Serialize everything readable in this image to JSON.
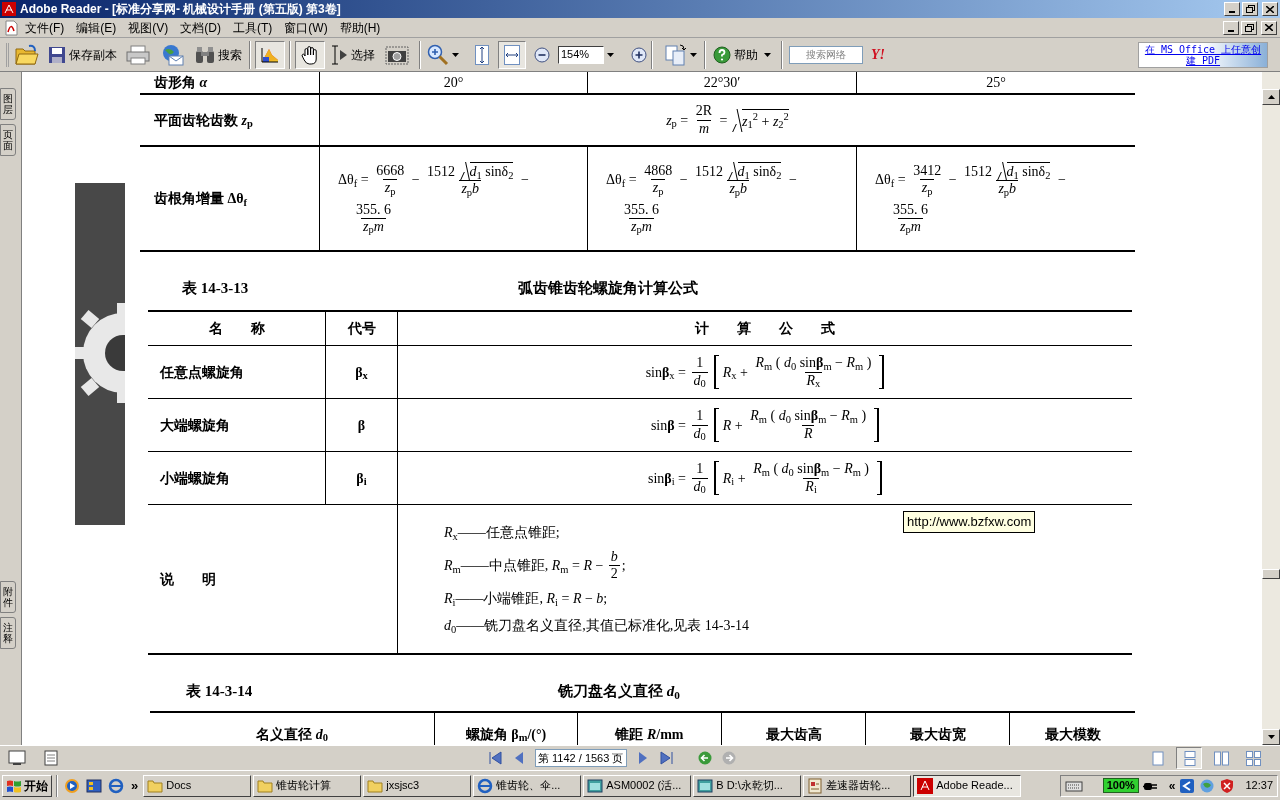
{
  "window": {
    "title": "Adobe Reader - [标准分享网- 机械设计手册 (第五版) 第3卷]"
  },
  "menu": [
    "文件(F)",
    "编辑(E)",
    "视图(V)",
    "文档(D)",
    "工具(T)",
    "窗口(W)",
    "帮助(H)"
  ],
  "toolbar": {
    "save_copy": "保存副本",
    "search": "搜索",
    "color_tool": {
      "selected": true
    },
    "hand_tool": {
      "selected": true
    },
    "select_tool": {
      "label": "选择",
      "selected": false
    },
    "fit_page": {
      "selected": false
    },
    "fit_width": {
      "selected": true
    },
    "zoom": "154%",
    "help": "帮助",
    "web_search": {
      "placeholder": "搜索网络"
    },
    "yahoo": "Y!",
    "promo_link": "在 MS Office 上任意创建 PDF"
  },
  "nav_tabs_top": [
    "图层",
    "页面"
  ],
  "nav_tabs_bottom": [
    "附件",
    "注释"
  ],
  "table_1": {
    "rows": [
      {
        "label": "齿形角 *α*",
        "cells": [
          {
            "kind": "text",
            "text": "20°"
          },
          {
            "kind": "text",
            "text": "22°30′"
          },
          {
            "kind": "text",
            "text": "25°"
          }
        ]
      },
      {
        "label": "平面齿轮齿数 *z*$_{p}$",
        "formula": {
          "lines": [
            [
              {
                "kind": "t",
                "text": "*z*$_{p}$ = "
              },
              {
                "kind": "frac",
                "num": [
                  {
                    "kind": "t",
                    "text": "2R"
                  }
                ],
                "den": [
                  {
                    "kind": "t",
                    "text": "*m*"
                  }
                ]
              },
              {
                "kind": "t",
                "text": " = "
              },
              {
                "kind": "sqrt",
                "body": [
                  {
                    "kind": "t",
                    "text": "*z*$_{1}$$^{2}$ + *z*$_{2}$$^{2}$"
                  }
                ]
              }
            ]
          ]
        }
      },
      {
        "label": "齿根角增量 Δθ$_{f}$",
        "cells": [
          {
            "kind": "formula",
            "lines": [
              [
                {
                  "kind": "t",
                  "text": "Δθ$_{f}$ = "
                },
                {
                  "kind": "frac",
                  "num": [
                    {
                      "kind": "t",
                      "text": "6668"
                    }
                  ],
                  "den": [
                    {
                      "kind": "t",
                      "text": "*z*$_{p}$"
                    }
                  ]
                },
                {
                  "kind": "t",
                  "text": " − "
                },
                {
                  "kind": "frac",
                  "num": [
                    {
                      "kind": "t",
                      "text": "1512 "
                    },
                    {
                      "kind": "sqrt",
                      "body": [
                        {
                          "kind": "t",
                          "text": "*d*$_{1}$ sinδ$_{2}$"
                        }
                      ]
                    }
                  ],
                  "den": [
                    {
                      "kind": "t",
                      "text": "*z*$_{p}$*b*"
                    }
                  ]
                },
                {
                  "kind": "t",
                  "text": " −"
                }
              ],
              [
                {
                  "kind": "frac",
                  "num": [
                    {
                      "kind": "t",
                      "text": "355. 6"
                    }
                  ],
                  "den": [
                    {
                      "kind": "t",
                      "text": "*z*$_{p}$*m*"
                    }
                  ]
                }
              ]
            ]
          },
          {
            "kind": "formula",
            "lines": [
              [
                {
                  "kind": "t",
                  "text": "Δθ$_{f}$ = "
                },
                {
                  "kind": "frac",
                  "num": [
                    {
                      "kind": "t",
                      "text": "4868"
                    }
                  ],
                  "den": [
                    {
                      "kind": "t",
                      "text": "*z*$_{p}$"
                    }
                  ]
                },
                {
                  "kind": "t",
                  "text": " − "
                },
                {
                  "kind": "frac",
                  "num": [
                    {
                      "kind": "t",
                      "text": "1512 "
                    },
                    {
                      "kind": "sqrt",
                      "body": [
                        {
                          "kind": "t",
                          "text": "*d*$_{1}$ sinδ$_{2}$"
                        }
                      ]
                    }
                  ],
                  "den": [
                    {
                      "kind": "t",
                      "text": "*z*$_{p}$*b*"
                    }
                  ]
                },
                {
                  "kind": "t",
                  "text": " −"
                }
              ],
              [
                {
                  "kind": "frac",
                  "num": [
                    {
                      "kind": "t",
                      "text": "355. 6"
                    }
                  ],
                  "den": [
                    {
                      "kind": "t",
                      "text": "*z*$_{p}$*m*"
                    }
                  ]
                }
              ]
            ]
          },
          {
            "kind": "formula",
            "lines": [
              [
                {
                  "kind": "t",
                  "text": "Δθ$_{f}$ = "
                },
                {
                  "kind": "frac",
                  "num": [
                    {
                      "kind": "t",
                      "text": "3412"
                    }
                  ],
                  "den": [
                    {
                      "kind": "t",
                      "text": "*z*$_{p}$"
                    }
                  ]
                },
                {
                  "kind": "t",
                  "text": " − "
                },
                {
                  "kind": "frac",
                  "num": [
                    {
                      "kind": "t",
                      "text": "1512 "
                    },
                    {
                      "kind": "sqrt",
                      "body": [
                        {
                          "kind": "t",
                          "text": "*d*$_{1}$ sinδ$_{2}$"
                        }
                      ]
                    }
                  ],
                  "den": [
                    {
                      "kind": "t",
                      "text": "*z*$_{p}$*b*"
                    }
                  ]
                },
                {
                  "kind": "t",
                  "text": " −"
                }
              ],
              [
                {
                  "kind": "frac",
                  "num": [
                    {
                      "kind": "t",
                      "text": "355. 6"
                    }
                  ],
                  "den": [
                    {
                      "kind": "t",
                      "text": "*z*$_{p}$*m*"
                    }
                  ]
                }
              ]
            ]
          }
        ]
      }
    ]
  },
  "table_2": {
    "number": "表 14-3-13",
    "title": "弧齿锥齿轮螺旋角计算公式",
    "columns": [
      "名　　称",
      "代号",
      "计　　算　　公　　式"
    ],
    "rows": [
      {
        "name": "任意点螺旋角",
        "symbol": "**β**$_{x}$",
        "formula": [
          {
            "kind": "t",
            "text": "sin**β**$_{x}$ = "
          },
          {
            "kind": "frac",
            "num": [
              {
                "kind": "t",
                "text": "1"
              }
            ],
            "den": [
              {
                "kind": "t",
                "text": "*d*$_{0}$"
              }
            ]
          },
          {
            "kind": "bracket",
            "body": [
              {
                "kind": "t",
                "text": "*R*$_{x}$ + "
              },
              {
                "kind": "frac",
                "num": [
                  {
                    "kind": "t",
                    "text": "*R*$_{m}$ ( *d*$_{0}$ sin**β**$_{m}$ − *R*$_{m}$ )"
                  }
                ],
                "den": [
                  {
                    "kind": "t",
                    "text": "*R*$_{x}$"
                  }
                ]
              }
            ]
          }
        ]
      },
      {
        "name": "大端螺旋角",
        "symbol": "**β**",
        "formula": [
          {
            "kind": "t",
            "text": "sin**β** = "
          },
          {
            "kind": "frac",
            "num": [
              {
                "kind": "t",
                "text": "1"
              }
            ],
            "den": [
              {
                "kind": "t",
                "text": "*d*$_{0}$"
              }
            ]
          },
          {
            "kind": "bracket",
            "body": [
              {
                "kind": "t",
                "text": "*R* + "
              },
              {
                "kind": "frac",
                "num": [
                  {
                    "kind": "t",
                    "text": "*R*$_{m}$ ( *d*$_{0}$ sin**β**$_{m}$ − *R*$_{m}$ )"
                  }
                ],
                "den": [
                  {
                    "kind": "t",
                    "text": "*R*"
                  }
                ]
              }
            ]
          }
        ]
      },
      {
        "name": "小端螺旋角",
        "symbol": "**β**$_{i}$",
        "formula": [
          {
            "kind": "t",
            "text": "sin**β**$_{i}$ = "
          },
          {
            "kind": "frac",
            "num": [
              {
                "kind": "t",
                "text": "1"
              }
            ],
            "den": [
              {
                "kind": "t",
                "text": "*d*$_{0}$"
              }
            ]
          },
          {
            "kind": "bracket",
            "body": [
              {
                "kind": "t",
                "text": "*R*$_{i}$ + "
              },
              {
                "kind": "frac",
                "num": [
                  {
                    "kind": "t",
                    "text": "*R*$_{m}$ ( *d*$_{0}$ sin**β**$_{m}$ − *R*$_{m}$ )"
                  }
                ],
                "den": [
                  {
                    "kind": "t",
                    "text": "*R*$_{i}$"
                  }
                ]
              }
            ]
          }
        ]
      }
    ],
    "notes_label": "说　　明",
    "notes": [
      [
        {
          "kind": "t",
          "text": "*R*$_{x}$——任意点锥距;"
        }
      ],
      [
        {
          "kind": "t",
          "text": "*R*$_{m}$——中点锥距, *R*$_{m}$ = *R* − "
        },
        {
          "kind": "frac",
          "num": [
            {
              "kind": "t",
              "text": "*b*"
            }
          ],
          "den": [
            {
              "kind": "t",
              "text": "2"
            }
          ]
        },
        {
          "kind": "t",
          "text": ";"
        }
      ],
      [
        {
          "kind": "t",
          "text": "*R*$_{i}$——小端锥距, *R*$_{i}$ = *R* − *b*;"
        }
      ],
      [
        {
          "kind": "t",
          "text": "*d*$_{0}$——铣刀盘名义直径,其值已标准化,见表 14-3-14"
        }
      ]
    ]
  },
  "table_3": {
    "number": "表 14-3-14",
    "title": "铣刀盘名义直径 *d*$_{0}$",
    "columns": [
      "名义直径 *d*$_{0}$",
      "螺旋角 **β**$_{m}$/(°)",
      "锥距 *R*/mm",
      "最大齿高",
      "最大齿宽",
      "最大模数"
    ]
  },
  "tooltip": "http://www.bzfxw.com",
  "status_bar": {
    "page_field": "第 1142 / 1563 页",
    "view_modes": [
      {
        "selected": false
      },
      {
        "selected": true
      },
      {
        "selected": false
      },
      {
        "selected": false
      }
    ]
  },
  "taskbar": {
    "start": "开始",
    "more": "»",
    "tasks": [
      {
        "kind": "folder",
        "label": "Docs",
        "selected": false
      },
      {
        "kind": "folder",
        "label": "锥齿轮计算",
        "selected": false
      },
      {
        "kind": "folder",
        "label": "jxsjsc3",
        "selected": false
      },
      {
        "kind": "browser",
        "label": "锥齿轮、伞...",
        "selected": false
      },
      {
        "kind": "app",
        "label": "ASM0002 (活...",
        "selected": false
      },
      {
        "kind": "app",
        "label": "B D:\\永乾切...",
        "selected": false
      },
      {
        "kind": "document",
        "label": "差速器齿轮...",
        "selected": false
      },
      {
        "kind": "reader",
        "label": "Adobe Reade...",
        "selected": true
      }
    ],
    "battery": "100%",
    "expand": "«",
    "clock": "12:37"
  }
}
